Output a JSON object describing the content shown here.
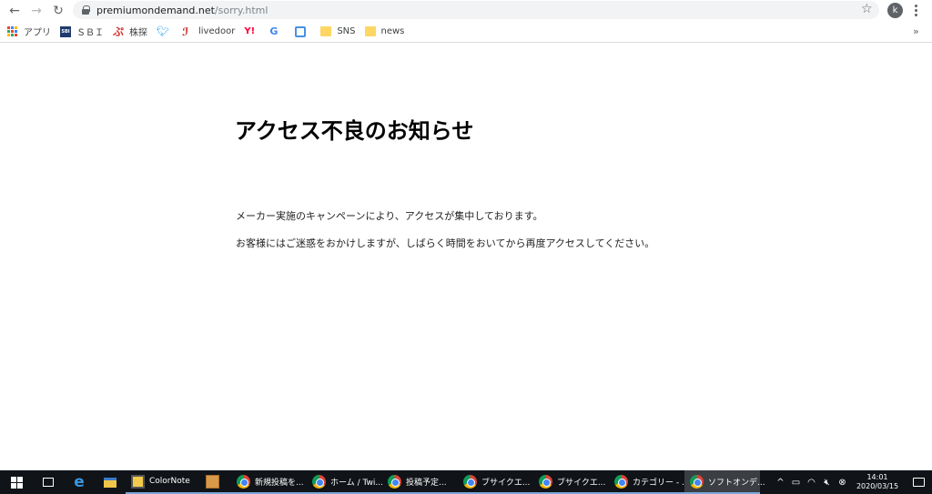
{
  "browser": {
    "url_host": "premiumondemand.net",
    "url_path": "/sorry.html",
    "profile_initial": "k"
  },
  "bookmarks": [
    {
      "label": "アプリ",
      "icon": "apps-grid-icon"
    },
    {
      "label": "ＳＢＩ",
      "icon": "sbi-icon"
    },
    {
      "label": "株探",
      "icon": "kabutan-icon"
    },
    {
      "label": "",
      "icon": "twitter-icon"
    },
    {
      "label": "livedoor",
      "icon": "livedoor-icon"
    },
    {
      "label": "",
      "icon": "yahoo-icon"
    },
    {
      "label": "",
      "icon": "google-icon"
    },
    {
      "label": "",
      "icon": "cube-icon"
    },
    {
      "label": "SNS",
      "icon": "folder-icon"
    },
    {
      "label": "news",
      "icon": "folder-icon"
    }
  ],
  "page": {
    "title": "アクセス不良のお知らせ",
    "message1": "メーカー実施のキャンペーンにより、アクセスが集中しております。",
    "message2": "お客様にはご迷惑をおかけしますが、しばらく時間をおいてから再度アクセスしてください。"
  },
  "taskbar": {
    "apps": [
      {
        "label": "ColorNote",
        "icon": "colornote-icon"
      },
      {
        "label": "",
        "icon": "photo-app-icon"
      },
      {
        "label": "新規投稿を...",
        "icon": "chrome-icon"
      },
      {
        "label": "ホーム / Twi...",
        "icon": "chrome-icon"
      },
      {
        "label": "投稿予定...",
        "icon": "chrome-icon"
      },
      {
        "label": "ブサイクエ...",
        "icon": "chrome-icon"
      },
      {
        "label": "ブサイクエ...",
        "icon": "chrome-icon"
      },
      {
        "label": "カテゴリー - ...",
        "icon": "chrome-icon"
      },
      {
        "label": "ソフトオンデ...",
        "icon": "chrome-icon"
      }
    ],
    "time": "14:01",
    "date": "2020/03/15"
  },
  "colors": {
    "taskbar_bg": "#101418",
    "omnibox_bg": "#f1f3f4",
    "active_task_bg": "#3b3f44"
  }
}
